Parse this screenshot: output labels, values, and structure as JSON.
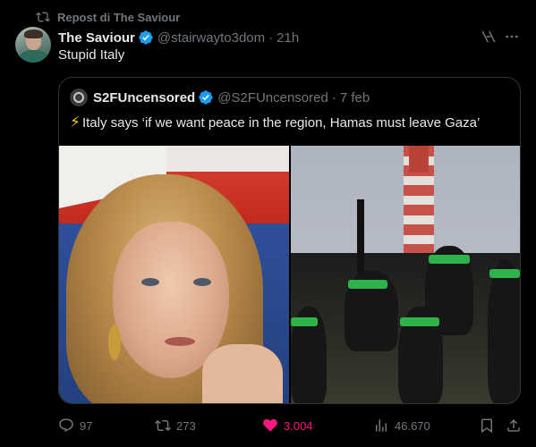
{
  "repost": {
    "label": "Repost di The Saviour"
  },
  "tweet": {
    "author_name": "The Saviour",
    "author_handle": "@stairwayto3dom",
    "separator": "·",
    "time": "21h",
    "text": "Stupid Italy"
  },
  "quote": {
    "author_name": "S2FUncensored",
    "author_handle": "@S2FUncensored",
    "separator": "·",
    "time": "7 feb",
    "bolt": "⚡",
    "text": "Italy says ‘if we want peace in the region, Hamas must leave Gaza’"
  },
  "actions": {
    "replies": "97",
    "reposts": "273",
    "likes": "3.004",
    "views": "46.670"
  },
  "colors": {
    "background": "#000000",
    "text": "#e7e9ea",
    "muted": "#71767b",
    "like": "#f91880",
    "verified": "#1d9bf0",
    "border": "#2f3336"
  },
  "icons": [
    "repost-icon",
    "verified-icon",
    "grok-icon",
    "more-icon",
    "reply-icon",
    "like-icon",
    "views-icon",
    "bookmark-icon",
    "share-icon"
  ]
}
